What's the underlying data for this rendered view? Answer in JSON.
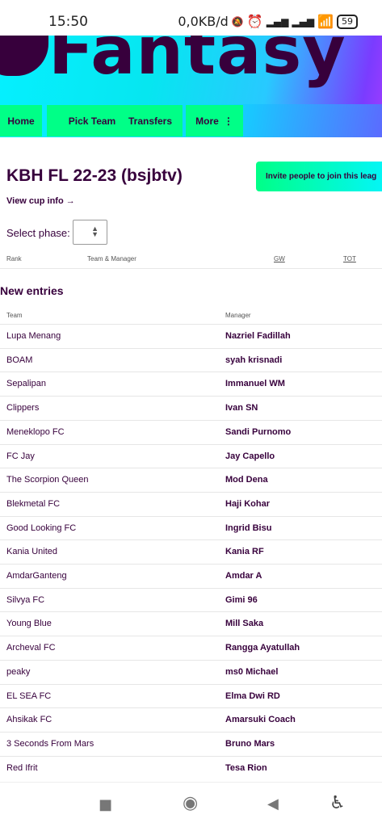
{
  "status_bar": {
    "time": "15:50",
    "data_rate": "0,0KB/d",
    "battery": "59"
  },
  "header": {
    "brand": "Fantasy"
  },
  "nav": {
    "tabs": [
      {
        "label": "Home"
      },
      {
        "label": "Pick Team"
      },
      {
        "label": "Transfers"
      },
      {
        "label": "More"
      }
    ]
  },
  "league": {
    "title": "KBH FL 22-23 (bsjbtv)",
    "invite_label": "Invite people to join this leag",
    "cup_link": "View cup info →",
    "phase_label": "Select phase:"
  },
  "standings": {
    "headers": {
      "rank": "Rank",
      "team": "Team & Manager",
      "gw": "GW",
      "tot": "TOT"
    }
  },
  "new_entries": {
    "title": "New entries",
    "headers": {
      "team": "Team",
      "manager": "Manager"
    },
    "rows": [
      {
        "team": "Lupa Menang",
        "manager": "Nazriel Fadillah"
      },
      {
        "team": "BOAM",
        "manager": "syah krisnadi"
      },
      {
        "team": "Sepalipan",
        "manager": "Immanuel WM"
      },
      {
        "team": "Clippers",
        "manager": "Ivan SN"
      },
      {
        "team": "Meneklopo FC",
        "manager": "Sandi Purnomo"
      },
      {
        "team": "FC Jay",
        "manager": "Jay Capello"
      },
      {
        "team": "The Scorpion Queen",
        "manager": "Mod Dena"
      },
      {
        "team": "Blekmetal FC",
        "manager": "Haji Kohar"
      },
      {
        "team": "Good Looking FC",
        "manager": "Ingrid Bisu"
      },
      {
        "team": "Kania United",
        "manager": "Kania RF"
      },
      {
        "team": "AmdarGanteng",
        "manager": "Amdar A"
      },
      {
        "team": "Silvya FC",
        "manager": "Gimi 96"
      },
      {
        "team": "Young Blue",
        "manager": "Mill Saka"
      },
      {
        "team": "Archeval FC",
        "manager": "Rangga Ayatullah"
      },
      {
        "team": "peaky",
        "manager": "ms0 Michael"
      },
      {
        "team": "EL SEA FC",
        "manager": "Elma Dwi RD"
      },
      {
        "team": "Ahsikak FC",
        "manager": "Amarsuki Coach"
      },
      {
        "team": "3 Seconds From Mars",
        "manager": "Bruno Mars"
      },
      {
        "team": "Red Ifrit",
        "manager": "Tesa Rion"
      }
    ]
  },
  "android_nav": {
    "icons": [
      "recents-icon",
      "home-icon",
      "back-icon",
      "accessibility-icon"
    ]
  }
}
